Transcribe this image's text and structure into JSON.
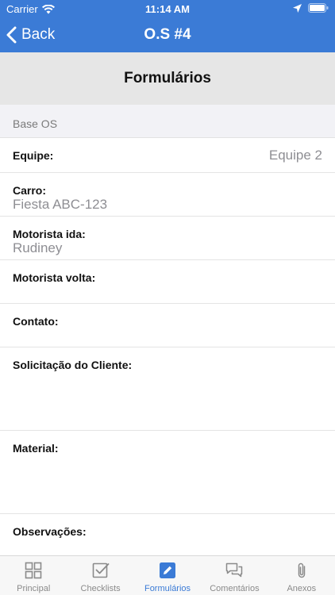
{
  "status": {
    "carrier": "Carrier",
    "time": "11:14 AM"
  },
  "nav": {
    "back_label": "Back",
    "title": "O.S #4"
  },
  "section_title": "Formulários",
  "group_title": "Base OS",
  "fields": {
    "equipe": {
      "label": "Equipe:",
      "value": "Equipe 2"
    },
    "carro": {
      "label": "Carro:",
      "value": "Fiesta ABC-123"
    },
    "motorista_ida": {
      "label": "Motorista ida:",
      "value": "Rudiney"
    },
    "motorista_volta": {
      "label": "Motorista volta:",
      "value": ""
    },
    "contato": {
      "label": "Contato:",
      "value": ""
    },
    "solicitacao": {
      "label": "Solicitação do Cliente:",
      "value": ""
    },
    "material": {
      "label": "Material:",
      "value": ""
    },
    "observacoes": {
      "label": "Observações:",
      "value": ""
    }
  },
  "tabs": [
    {
      "label": "Principal",
      "icon": "dashboard-icon"
    },
    {
      "label": "Checklists",
      "icon": "checkbox-icon"
    },
    {
      "label": "Formulários",
      "icon": "edit-form-icon",
      "active": true
    },
    {
      "label": "Comentários",
      "icon": "chat-bubbles-icon"
    },
    {
      "label": "Anexos",
      "icon": "paperclip-icon"
    }
  ],
  "colors": {
    "accent": "#3b7bd6",
    "header_gray": "#e6e6e6",
    "value_gray": "#8e8e93"
  }
}
